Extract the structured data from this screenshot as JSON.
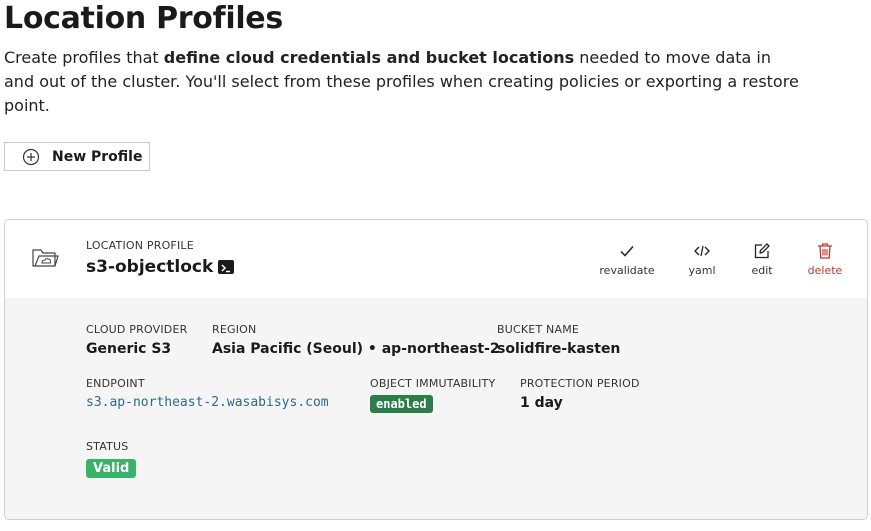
{
  "header": {
    "title": "Location Profiles",
    "intro_pre": "Create profiles that ",
    "intro_bold": "define cloud credentials and bucket locations",
    "intro_post": " needed to move data in and out of the cluster. You'll select from these profiles when creating policies or exporting a restore point."
  },
  "toolbar": {
    "new_profile_label": "New Profile"
  },
  "profile": {
    "type_label": "LOCATION PROFILE",
    "name": "s3-objectlock",
    "actions": {
      "revalidate": "revalidate",
      "yaml": "yaml",
      "edit": "edit",
      "delete": "delete"
    },
    "details": {
      "cloud_provider_label": "CLOUD PROVIDER",
      "cloud_provider": "Generic S3",
      "region_label": "REGION",
      "region": "Asia Pacific (Seoul) • ap-northeast-2",
      "bucket_label": "BUCKET NAME",
      "bucket": "solidfire-kasten",
      "endpoint_label": "ENDPOINT",
      "endpoint": "s3.ap-northeast-2.wasabisys.com",
      "immutability_label": "OBJECT IMMUTABILITY",
      "immutability": "enabled",
      "protection_label": "PROTECTION PERIOD",
      "protection": "1 day",
      "status_label": "STATUS",
      "status": "Valid"
    }
  },
  "colors": {
    "delete": "#c0392b",
    "enabled_badge": "#2d7d4a",
    "valid_badge": "#3ab26a",
    "endpoint_text": "#2b6a8c"
  },
  "icons": {
    "new_profile": "plus-circle-icon",
    "profile": "folder-cloud-icon",
    "terminal": "terminal-icon",
    "revalidate": "check-icon",
    "yaml": "code-icon",
    "edit": "edit-icon",
    "delete": "trash-icon"
  }
}
